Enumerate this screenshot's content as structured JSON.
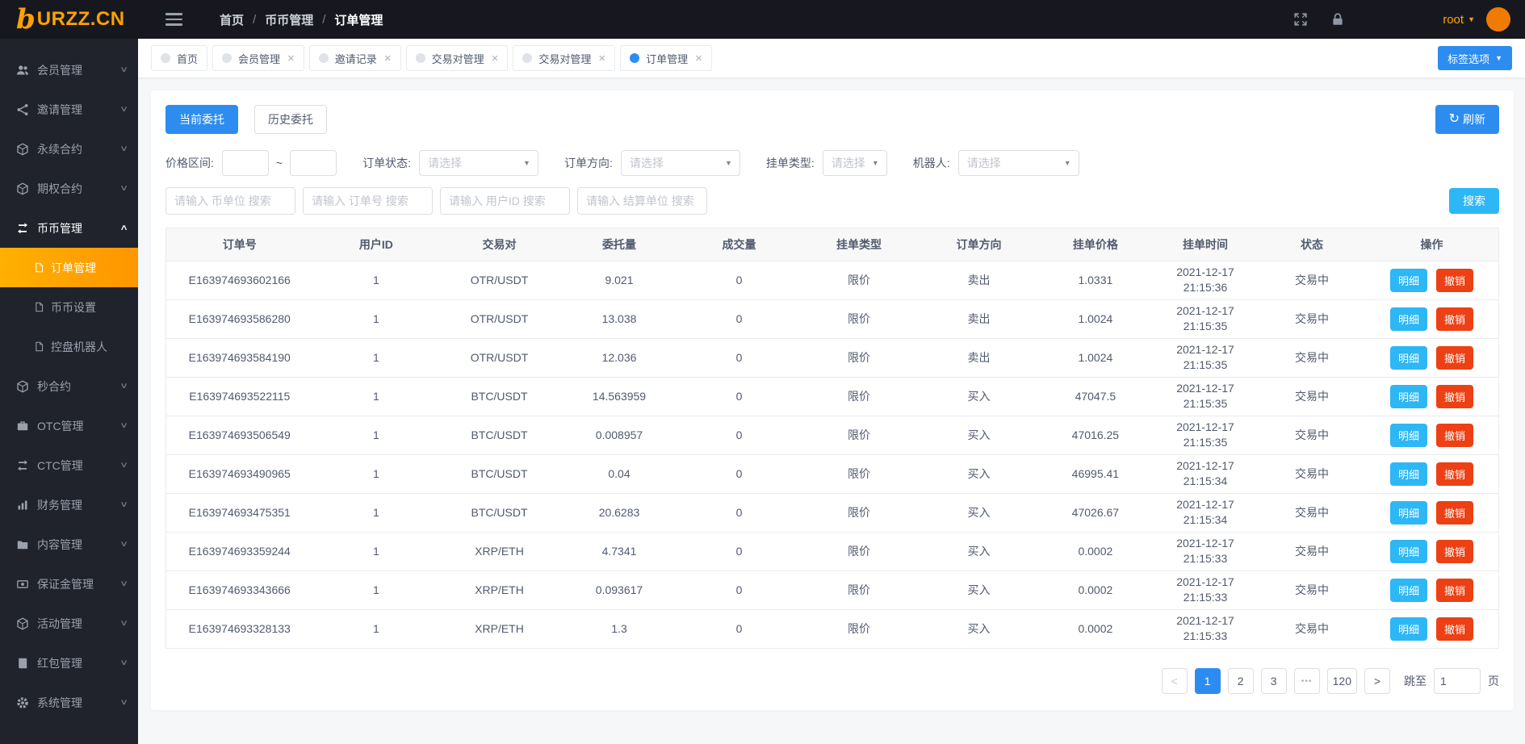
{
  "header": {
    "logo_mark": "b",
    "logo_text": "URZZ.CN",
    "breadcrumb": [
      "首页",
      "币币管理",
      "订单管理"
    ],
    "username": "root"
  },
  "glyphs": {
    "caret_down": "▼",
    "chevron_down": "∨",
    "chevron_up": "∧",
    "close": "×",
    "refresh": "↻",
    "prev": "<",
    "next": ">"
  },
  "tabbar": {
    "tabs": [
      {
        "label": "首页"
      },
      {
        "label": "会员管理"
      },
      {
        "label": "邀请记录"
      },
      {
        "label": "交易对管理"
      },
      {
        "label": "交易对管理"
      },
      {
        "label": "订单管理"
      }
    ],
    "options_button": "标签选项"
  },
  "sidebar": {
    "items": [
      {
        "label": "会员管理"
      },
      {
        "label": "邀请管理"
      },
      {
        "label": "永续合约"
      },
      {
        "label": "期权合约"
      },
      {
        "label": "币币管理",
        "children": [
          {
            "label": "订单管理"
          },
          {
            "label": "币币设置"
          },
          {
            "label": "控盘机器人"
          }
        ]
      },
      {
        "label": "秒合约"
      },
      {
        "label": "OTC管理"
      },
      {
        "label": "CTC管理"
      },
      {
        "label": "财务管理"
      },
      {
        "label": "内容管理"
      },
      {
        "label": "保证金管理"
      },
      {
        "label": "活动管理"
      },
      {
        "label": "红包管理"
      },
      {
        "label": "系统管理"
      }
    ]
  },
  "toolbar": {
    "current_label": "当前委托",
    "history_label": "历史委托",
    "refresh_label": "刷新"
  },
  "filters": {
    "price_range_label": "价格区间:",
    "tilde": "~",
    "status_label": "订单状态:",
    "side_label": "订单方向:",
    "type_label": "挂单类型:",
    "robot_label": "机器人:",
    "select_placeholder": "请选择",
    "search_placeholders": [
      "请输入 币单位 搜索",
      "请输入 订单号 搜索",
      "请输入 用户ID 搜索",
      "请输入 结算单位 搜索"
    ],
    "search_button": "搜索"
  },
  "table": {
    "columns": [
      "订单号",
      "用户ID",
      "交易对",
      "委托量",
      "成交量",
      "挂单类型",
      "订单方向",
      "挂单价格",
      "挂单时间",
      "状态",
      "操作"
    ],
    "detail_label": "明细",
    "cancel_label": "撤销",
    "rows": [
      {
        "order_no": "E163974693602166",
        "user_id": "1",
        "pair": "OTR/USDT",
        "amount": "9.021",
        "filled": "0",
        "type": "限价",
        "side": "卖出",
        "price": "1.0331",
        "date": "2021-12-17",
        "time": "21:15:36",
        "status": "交易中"
      },
      {
        "order_no": "E163974693586280",
        "user_id": "1",
        "pair": "OTR/USDT",
        "amount": "13.038",
        "filled": "0",
        "type": "限价",
        "side": "卖出",
        "price": "1.0024",
        "date": "2021-12-17",
        "time": "21:15:35",
        "status": "交易中"
      },
      {
        "order_no": "E163974693584190",
        "user_id": "1",
        "pair": "OTR/USDT",
        "amount": "12.036",
        "filled": "0",
        "type": "限价",
        "side": "卖出",
        "price": "1.0024",
        "date": "2021-12-17",
        "time": "21:15:35",
        "status": "交易中"
      },
      {
        "order_no": "E163974693522115",
        "user_id": "1",
        "pair": "BTC/USDT",
        "amount": "14.563959",
        "filled": "0",
        "type": "限价",
        "side": "买入",
        "price": "47047.5",
        "date": "2021-12-17",
        "time": "21:15:35",
        "status": "交易中"
      },
      {
        "order_no": "E163974693506549",
        "user_id": "1",
        "pair": "BTC/USDT",
        "amount": "0.008957",
        "filled": "0",
        "type": "限价",
        "side": "买入",
        "price": "47016.25",
        "date": "2021-12-17",
        "time": "21:15:35",
        "status": "交易中"
      },
      {
        "order_no": "E163974693490965",
        "user_id": "1",
        "pair": "BTC/USDT",
        "amount": "0.04",
        "filled": "0",
        "type": "限价",
        "side": "买入",
        "price": "46995.41",
        "date": "2021-12-17",
        "time": "21:15:34",
        "status": "交易中"
      },
      {
        "order_no": "E163974693475351",
        "user_id": "1",
        "pair": "BTC/USDT",
        "amount": "20.6283",
        "filled": "0",
        "type": "限价",
        "side": "买入",
        "price": "47026.67",
        "date": "2021-12-17",
        "time": "21:15:34",
        "status": "交易中"
      },
      {
        "order_no": "E163974693359244",
        "user_id": "1",
        "pair": "XRP/ETH",
        "amount": "4.7341",
        "filled": "0",
        "type": "限价",
        "side": "买入",
        "price": "0.0002",
        "date": "2021-12-17",
        "time": "21:15:33",
        "status": "交易中"
      },
      {
        "order_no": "E163974693343666",
        "user_id": "1",
        "pair": "XRP/ETH",
        "amount": "0.093617",
        "filled": "0",
        "type": "限价",
        "side": "买入",
        "price": "0.0002",
        "date": "2021-12-17",
        "time": "21:15:33",
        "status": "交易中"
      },
      {
        "order_no": "E163974693328133",
        "user_id": "1",
        "pair": "XRP/ETH",
        "amount": "1.3",
        "filled": "0",
        "type": "限价",
        "side": "买入",
        "price": "0.0002",
        "date": "2021-12-17",
        "time": "21:15:33",
        "status": "交易中"
      }
    ]
  },
  "pagination": {
    "pages": [
      "1",
      "2",
      "3",
      "•••",
      "120"
    ],
    "active_page": "1",
    "jump_label": "跳至",
    "jump_value": "1",
    "page_unit": "页"
  },
  "colors": {
    "primary_blue": "#2d8cf0",
    "info_blue": "#2db7f5",
    "danger_red": "#ed4014",
    "accent_orange": "#ffa200",
    "active_menu_orange": "#ffa000",
    "header_bg": "#17181f",
    "sidebar_bg": "#20222c"
  }
}
